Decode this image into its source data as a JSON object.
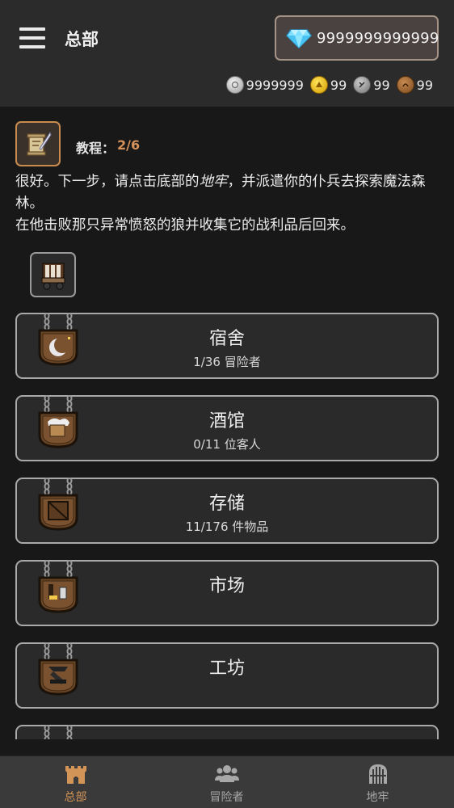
{
  "header": {
    "title": "总部",
    "gems": "9999999999999"
  },
  "currencies": [
    {
      "icon": "silver-coin-icon",
      "value": "9999999"
    },
    {
      "icon": "gold-coin-icon",
      "value": "99"
    },
    {
      "icon": "grey-coin-icon",
      "value": "99"
    },
    {
      "icon": "bronze-coin-icon",
      "value": "99"
    }
  ],
  "tutorial": {
    "label": "教程：",
    "step": "2/6",
    "text_before": "很好。下一步，请点击底部的",
    "text_emph": "地牢",
    "text_after": "，并派遣你的仆兵去探索魔法森林。",
    "text_line2": "在他击败那只异常愤怒的狼并收集它的战利品后回来。"
  },
  "buildings": [
    {
      "name": "宿舍",
      "sub": "1/36 冒险者",
      "icon": "moon-sign-icon"
    },
    {
      "name": "酒馆",
      "sub": "0/11 位客人",
      "icon": "mug-sign-icon"
    },
    {
      "name": "存储",
      "sub": "11/176 件物品",
      "icon": "crate-sign-icon"
    },
    {
      "name": "市场",
      "sub": "",
      "icon": "market-sign-icon"
    },
    {
      "name": "工坊",
      "sub": "",
      "icon": "workshop-sign-icon"
    }
  ],
  "nav": [
    {
      "label": "总部",
      "icon": "castle-icon",
      "active": true
    },
    {
      "label": "冒险者",
      "icon": "group-icon",
      "active": false
    },
    {
      "label": "地牢",
      "icon": "dungeon-gate-icon",
      "active": false
    }
  ],
  "colors": {
    "accent": "#d39457",
    "background": "#181818",
    "topbar": "#2b2b2b",
    "card_border": "#a9a9a9"
  }
}
